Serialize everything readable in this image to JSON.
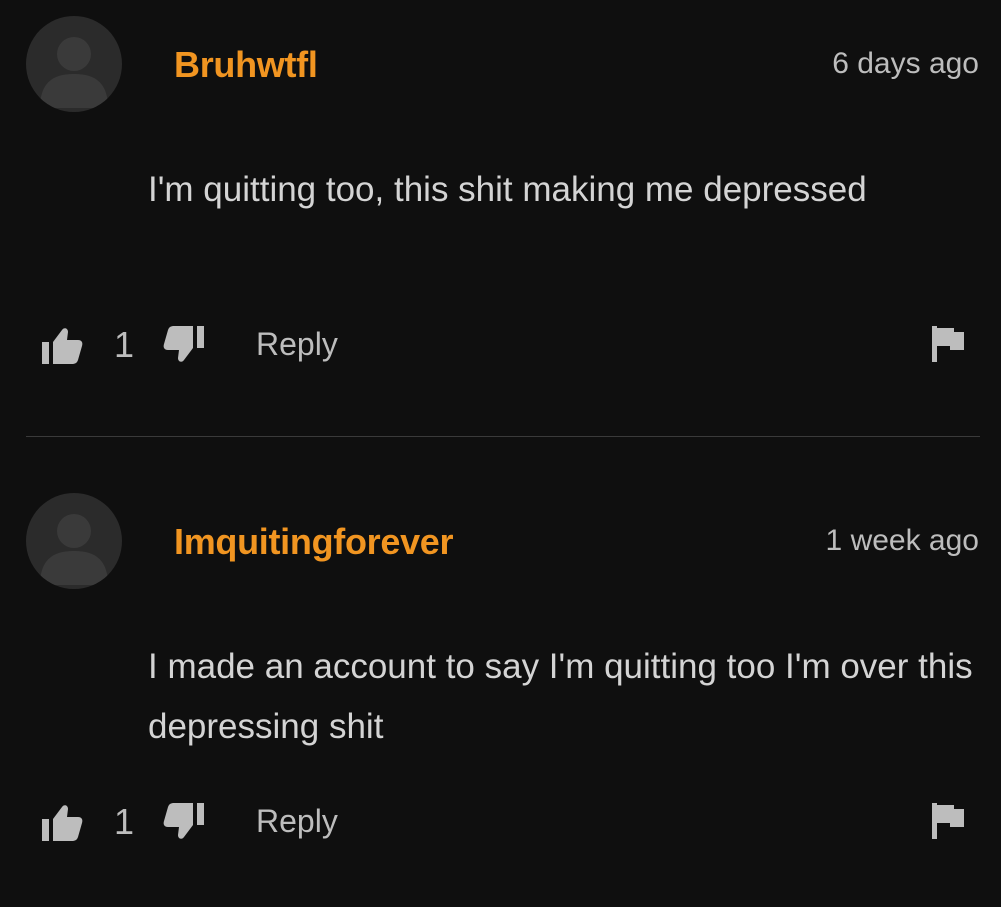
{
  "colors": {
    "background": "#0f0f0f",
    "username": "#f19521",
    "text": "#d4d4d4",
    "muted": "#bdbdbd"
  },
  "comments": [
    {
      "username": "Bruhwtfl",
      "timestamp": "6 days ago",
      "text": "I'm quitting too, this shit making me depressed",
      "likes": "1",
      "reply_label": "Reply",
      "icons": [
        "avatar-placeholder",
        "thumbs-up-icon",
        "thumbs-down-icon",
        "flag-icon"
      ]
    },
    {
      "username": "Imquitingforever",
      "timestamp": "1 week ago",
      "text": "I made an account to say I'm quitting too I'm over this depressing shit",
      "likes": "1",
      "reply_label": "Reply",
      "icons": [
        "avatar-placeholder",
        "thumbs-up-icon",
        "thumbs-down-icon",
        "flag-icon"
      ]
    }
  ]
}
